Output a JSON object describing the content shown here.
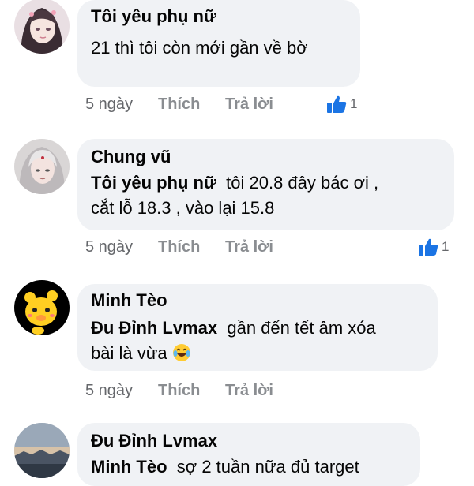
{
  "comments": [
    {
      "author": "Tôi yêu phụ nữ",
      "mention": "",
      "text": "21 thì tôi còn mới gần về bờ",
      "time": "5 ngày",
      "like_label": "Thích",
      "reply_label": "Trả lời",
      "reaction_count": "1",
      "avatar_icon": "anime-girl-avatar"
    },
    {
      "author": "Chung vũ",
      "mention": "Tôi yêu phụ nữ",
      "text": "tôi 20.8 đây bác ơi ,",
      "text2": "cắt lỗ 18.3 , vào lại 15.8",
      "time": "5 ngày",
      "like_label": "Thích",
      "reply_label": "Trả lời",
      "reaction_count": "1",
      "avatar_icon": "silver-hair-warrior-avatar"
    },
    {
      "author": "Minh Tèo",
      "mention": "Đu Đỉnh Lvmax",
      "text": "gần đến tết âm xóa",
      "text2": "bài là vừa",
      "time": "5 ngày",
      "like_label": "Thích",
      "reply_label": "Trả lời",
      "avatar_icon": "yellow-bear-avatar"
    },
    {
      "author": "Đu Đỉnh Lvmax",
      "mention": "Minh Tèo",
      "text": "sợ 2 tuần nữa đủ target",
      "avatar_icon": "sunset-landscape-avatar"
    }
  ],
  "colors": {
    "bubble": "#f0f2f5",
    "like_blue": "#1b74e4",
    "meta_gray": "#65676b"
  }
}
